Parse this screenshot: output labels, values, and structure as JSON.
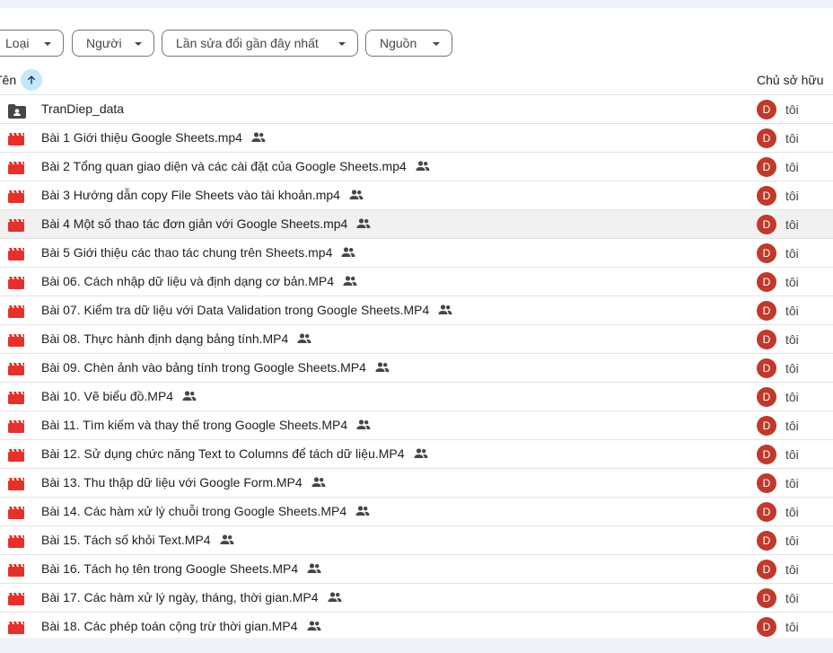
{
  "filters": {
    "type_label": "Loại",
    "people_label": "Người",
    "modified_label": "Lần sửa đổi gần đây nhất",
    "source_label": "Nguồn"
  },
  "columns": {
    "name": "Tên",
    "owner": "Chủ sở hữu"
  },
  "colors": {
    "avatar": "#c0392b",
    "video_icon": "#e5312b",
    "sort_bg": "#c2e7ff"
  },
  "rows": [
    {
      "name": "TranDiep_data",
      "icon": "shared-folder-icon",
      "owner_initial": "D",
      "owner": "tôi",
      "shared": false
    },
    {
      "name": "Bài 1 Giới thiệu Google Sheets.mp4",
      "icon": "video-file-icon",
      "owner_initial": "D",
      "owner": "tôi",
      "shared": true
    },
    {
      "name": "Bài 2 Tổng quan giao diện và các cài đặt của Google Sheets.mp4",
      "icon": "video-file-icon",
      "owner_initial": "D",
      "owner": "tôi",
      "shared": true
    },
    {
      "name": "Bài 3 Hướng dẫn copy File Sheets vào tài khoản.mp4",
      "icon": "video-file-icon",
      "owner_initial": "D",
      "owner": "tôi",
      "shared": true
    },
    {
      "name": "Bài 4 Một số thao tác đơn giản với Google Sheets.mp4",
      "icon": "video-file-icon",
      "owner_initial": "D",
      "owner": "tôi",
      "shared": true
    },
    {
      "name": "Bài 5 Giới thiệu các thao tác chung trên Sheets.mp4",
      "icon": "video-file-icon",
      "owner_initial": "D",
      "owner": "tôi",
      "shared": true
    },
    {
      "name": "Bài 06. Cách nhập dữ liệu và định dạng cơ bản.MP4",
      "icon": "video-file-icon",
      "owner_initial": "D",
      "owner": "tôi",
      "shared": true
    },
    {
      "name": "Bài 07. Kiểm tra dữ liệu với Data Validation trong Google Sheets.MP4",
      "icon": "video-file-icon",
      "owner_initial": "D",
      "owner": "tôi",
      "shared": true
    },
    {
      "name": "Bài 08. Thực hành định dạng bảng tính.MP4",
      "icon": "video-file-icon",
      "owner_initial": "D",
      "owner": "tôi",
      "shared": true
    },
    {
      "name": "Bài 09. Chèn ảnh vào bảng tính trong Google Sheets.MP4",
      "icon": "video-file-icon",
      "owner_initial": "D",
      "owner": "tôi",
      "shared": true
    },
    {
      "name": "Bài 10. Vẽ biểu đồ.MP4",
      "icon": "video-file-icon",
      "owner_initial": "D",
      "owner": "tôi",
      "shared": true
    },
    {
      "name": "Bài 11. Tìm kiếm và thay thế trong Google Sheets.MP4",
      "icon": "video-file-icon",
      "owner_initial": "D",
      "owner": "tôi",
      "shared": true
    },
    {
      "name": "Bài 12. Sử dụng chức năng Text to Columns để tách dữ liệu.MP4",
      "icon": "video-file-icon",
      "owner_initial": "D",
      "owner": "tôi",
      "shared": true
    },
    {
      "name": "Bài 13. Thu thập dữ liệu với Google Form.MP4",
      "icon": "video-file-icon",
      "owner_initial": "D",
      "owner": "tôi",
      "shared": true
    },
    {
      "name": "Bài 14. Các hàm xử lý chuỗi trong Google Sheets.MP4",
      "icon": "video-file-icon",
      "owner_initial": "D",
      "owner": "tôi",
      "shared": true
    },
    {
      "name": "Bài 15. Tách số khỏi Text.MP4",
      "icon": "video-file-icon",
      "owner_initial": "D",
      "owner": "tôi",
      "shared": true
    },
    {
      "name": "Bài 16. Tách họ tên trong Google Sheets.MP4",
      "icon": "video-file-icon",
      "owner_initial": "D",
      "owner": "tôi",
      "shared": true
    },
    {
      "name": "Bài 17. Các hàm xử lý ngày, tháng, thời gian.MP4",
      "icon": "video-file-icon",
      "owner_initial": "D",
      "owner": "tôi",
      "shared": true
    },
    {
      "name": "Bài 18. Các phép toán cộng trừ thời gian.MP4",
      "icon": "video-file-icon",
      "owner_initial": "D",
      "owner": "tôi",
      "shared": true
    }
  ]
}
